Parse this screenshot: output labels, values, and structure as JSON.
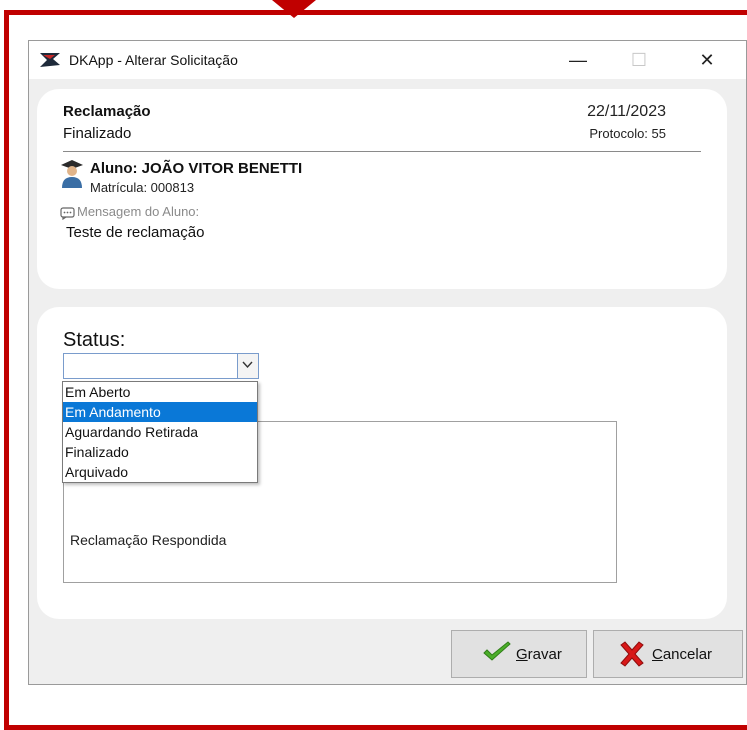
{
  "window": {
    "title": "DKApp - Alterar Solicitação",
    "controls": {
      "minimize": "—",
      "maximize": "☐",
      "close": "✕"
    }
  },
  "request": {
    "type": "Reclamação",
    "state": "Finalizado",
    "date": "22/11/2023",
    "protocol": "Protocolo: 55"
  },
  "student": {
    "label": "Aluno:  JOÃO VITOR BENETTI",
    "registration": "Matrícula: 000813",
    "message_label": "Mensagem do Aluno:",
    "message": "Teste de reclamação"
  },
  "status": {
    "label": "Status:",
    "selected": "",
    "options": [
      "Em Aberto",
      "Em Andamento",
      "Aguardando Retirada",
      "Finalizado",
      "Arquivado"
    ],
    "highlighted_index": 1
  },
  "response": {
    "text": "Reclamação Respondida"
  },
  "buttons": {
    "save_first": "G",
    "save_rest": "ravar",
    "cancel_first": "C",
    "cancel_rest": "ancelar"
  },
  "colors": {
    "annotation": "#c00000",
    "selection": "#0a78d7",
    "save_icon": "#4cae2a",
    "cancel_icon": "#d81818"
  }
}
